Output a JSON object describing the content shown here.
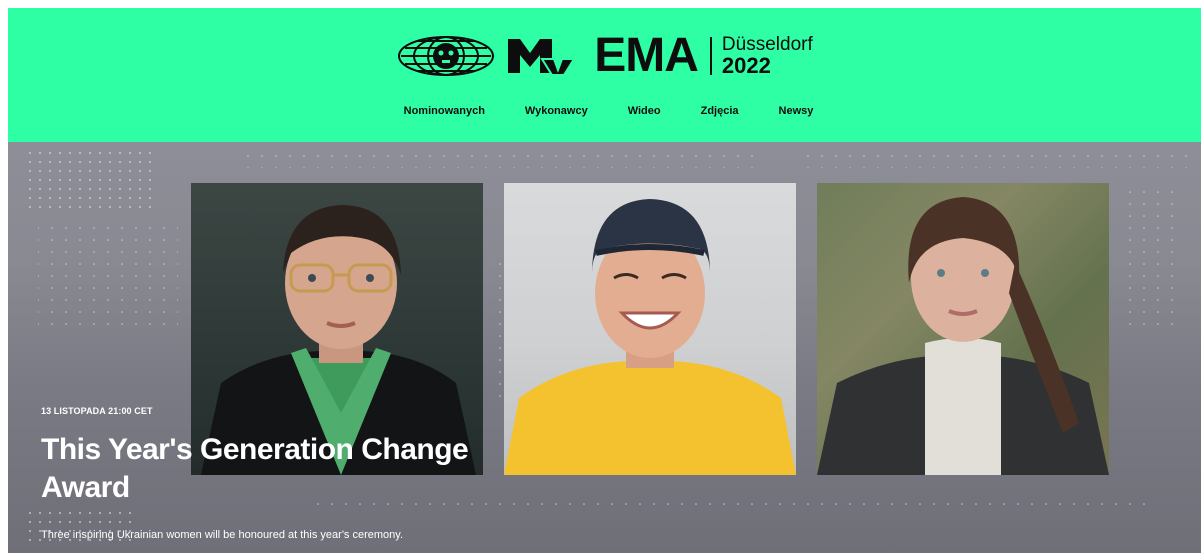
{
  "brand": {
    "ema": "EMA",
    "city": "Düsseldorf",
    "year": "2022"
  },
  "nav": [
    {
      "label": "Nominowanych"
    },
    {
      "label": "Wykonawcy"
    },
    {
      "label": "Wideo"
    },
    {
      "label": "Zdjęcia"
    },
    {
      "label": "Newsy"
    }
  ],
  "hero": {
    "date": "13 LISTOPADA 21:00 CET",
    "title_line1": "This Year's Generation Change",
    "title_line2": "Award",
    "description": "Three inspiring Ukrainian women will be honoured at this year's ceremony."
  },
  "colors": {
    "header_bg": "#2fffa4",
    "text_dark": "#0d0d0d",
    "hero_text": "#ffffff"
  }
}
